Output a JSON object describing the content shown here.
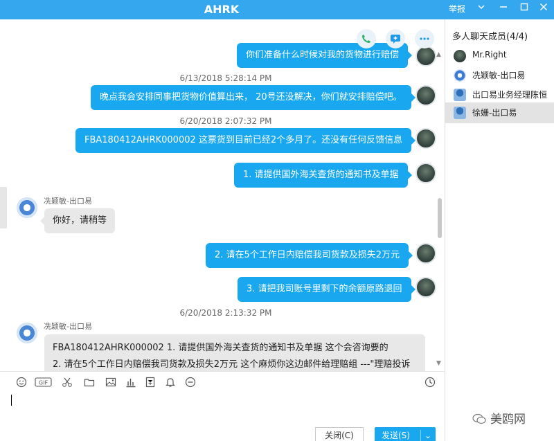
{
  "window": {
    "title": "AHRK",
    "report": "举报",
    "btn_min": "—",
    "btn_max": "☐",
    "btn_close": "✕"
  },
  "actions": [
    {
      "icon": "phone-icon"
    },
    {
      "icon": "message-add-icon"
    },
    {
      "icon": "more-icon"
    }
  ],
  "messages": {
    "m0": "你们准备什么时候对我的货物进行赔偿",
    "t1": "6/13/2018 5:28:14 PM",
    "m1": "晚点我会安排同事把货物价值算出来， 20号还没解决，你们就安排赔偿吧。",
    "t2": "6/20/2018 2:07:32 PM",
    "m2": "FBA180412AHRK000002  这票货到目前已经2个多月了。还没有任何反馈信息",
    "m3": "1. 请提供国外海关查货的通知书及单据",
    "s1": "冼颖敏-出口易",
    "m4": "你好，请稍等",
    "m5": "2. 请在5个工作日内赔偿我司货款及损失2万元",
    "m6": "3. 请把我司账号里剩下的余额原路退回",
    "t3": "6/20/2018 2:13:32 PM",
    "s2": "冼颖敏-出口易",
    "m7a": "FBA180412AHRK000002 1. 请提供国外海关查货的通知书及单据 这个会咨询要的",
    "m7b": "2. 请在5个工作日内赔偿我司货款及损失2万元 这个麻烦你这边邮件给理赔组 ---\"理赔投诉"
  },
  "toolbar": {
    "tools": [
      "emoji-icon",
      "gif-icon",
      "scissors-icon",
      "folder-icon",
      "image-icon",
      "chart-icon",
      "receipt-icon",
      "bell-icon",
      "minus-circle-icon"
    ],
    "gif": "GIF",
    "history": "history-icon"
  },
  "buttons": {
    "close": "关闭(C)",
    "send": "发送(S)",
    "send_arrow": "⌄"
  },
  "members": {
    "title": "多人聊天成员(4/4)",
    "list": [
      {
        "name": "Mr.Right",
        "avatar": "user"
      },
      {
        "name": "冼颖敏-出口易",
        "avatar": "agent"
      },
      {
        "name": "出口易业务经理陈恒",
        "avatar": "agent2"
      },
      {
        "name": "徐姗-出口易",
        "avatar": "agent2",
        "selected": true
      }
    ]
  },
  "watermark": "美鸥网",
  "colors": {
    "accent": "#35a7ee",
    "bubble_out": "#19a8f0",
    "bubble_in": "#e8e8e8"
  }
}
